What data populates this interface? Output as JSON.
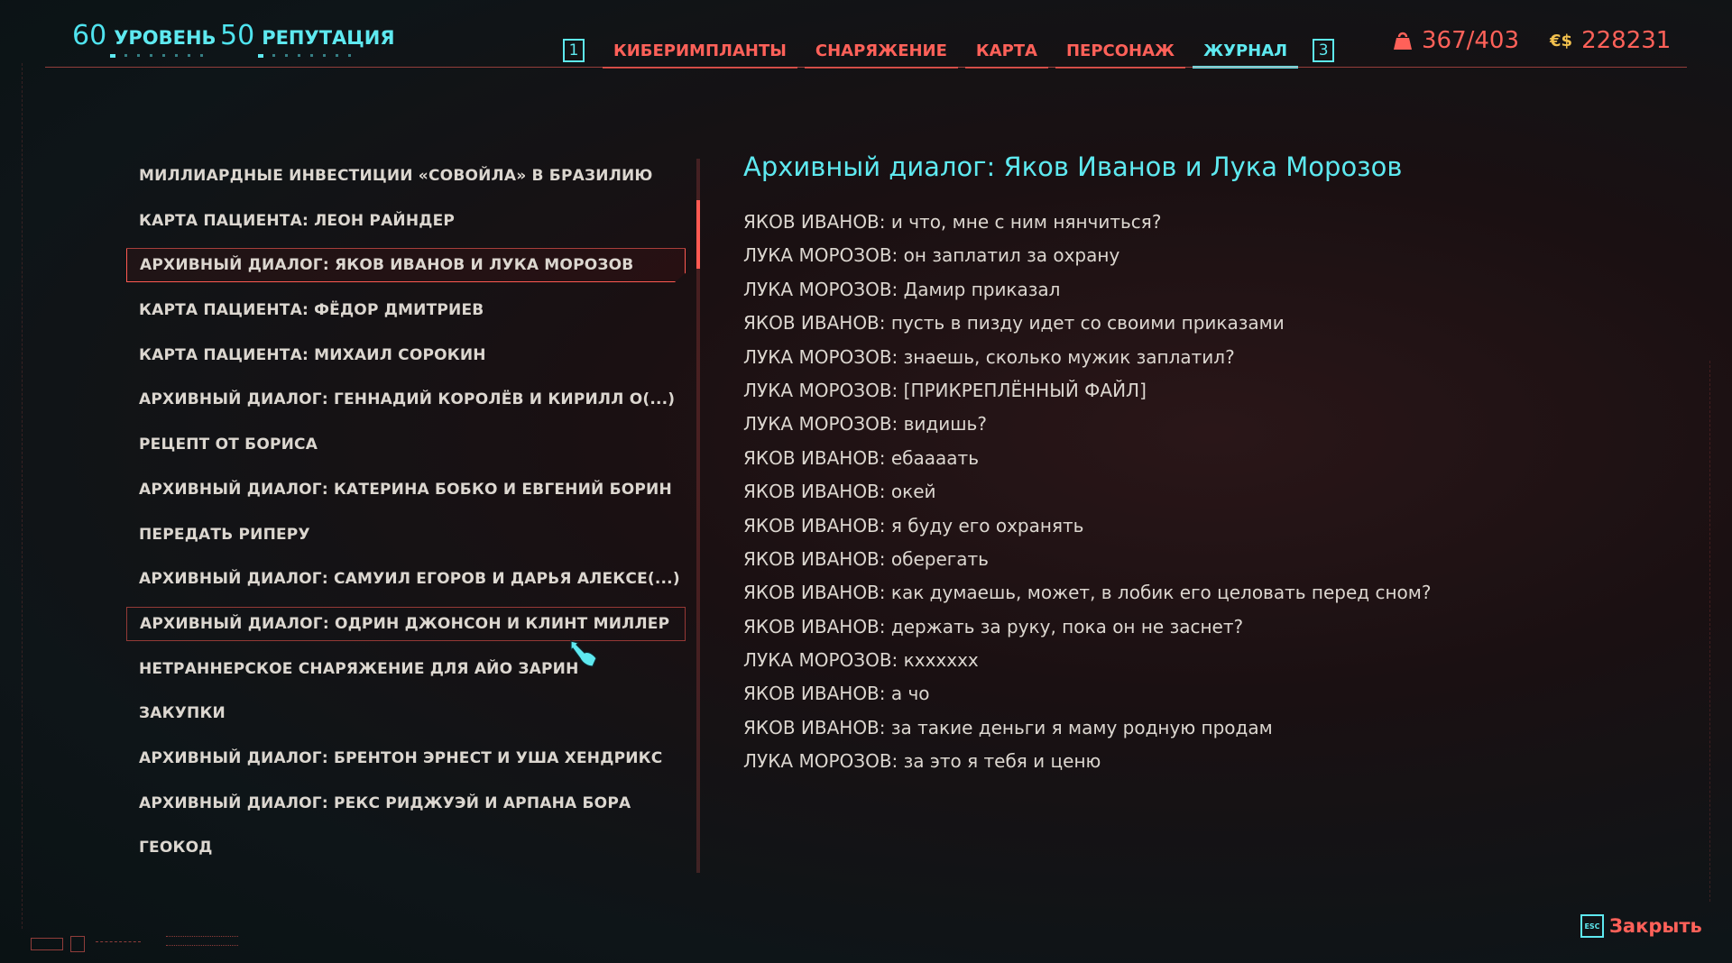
{
  "header": {
    "level": {
      "value": "60",
      "label": "УРОВЕНЬ"
    },
    "reputation": {
      "value": "50",
      "label": "РЕПУТАЦИЯ"
    },
    "nav": {
      "prev_key": "1",
      "next_key": "3",
      "tabs": [
        {
          "label": "КИБЕРИМПЛАНТЫ",
          "active": false
        },
        {
          "label": "СНАРЯЖЕНИЕ",
          "active": false
        },
        {
          "label": "КАРТА",
          "active": false
        },
        {
          "label": "ПЕРСОНАЖ",
          "active": false
        },
        {
          "label": "ЖУРНАЛ",
          "active": true
        }
      ]
    },
    "carry_weight": "367/403",
    "money": {
      "symbol": "€$",
      "value": "228231"
    }
  },
  "journal_list": {
    "items": [
      {
        "label": "МИЛЛИАРДНЫЕ ИНВЕСТИЦИИ «СОВОЙЛА» В БРАЗИЛИЮ"
      },
      {
        "label": "КАРТА ПАЦИЕНТА: ЛЕОН РАЙНДЕР"
      },
      {
        "label": "АРХИВНЫЙ ДИАЛОГ: ЯКОВ ИВАНОВ И ЛУКА МОРОЗОВ",
        "selected": true
      },
      {
        "label": "КАРТА ПАЦИЕНТА: ФЁДОР ДМИТРИЕВ"
      },
      {
        "label": "КАРТА ПАЦИЕНТА: МИХАИЛ СОРОКИН"
      },
      {
        "label": "АРХИВНЫЙ ДИАЛОГ: ГЕННАДИЙ КОРОЛЁВ И КИРИЛЛ О(...)"
      },
      {
        "label": "РЕЦЕПТ ОТ БОРИСА"
      },
      {
        "label": "АРХИВНЫЙ ДИАЛОГ: КАТЕРИНА БОБКО И ЕВГЕНИЙ БОРИН"
      },
      {
        "label": "ПЕРЕДАТЬ РИПЕРУ"
      },
      {
        "label": "АРХИВНЫЙ ДИАЛОГ: САМУИЛ ЕГОРОВ И ДАРЬЯ АЛЕКСЕ(...)"
      },
      {
        "label": "АРХИВНЫЙ ДИАЛОГ: ОДРИН ДЖОНСОН И КЛИНТ МИЛЛЕР",
        "hovered": true
      },
      {
        "label": "НЕТРАННЕРСКОЕ СНАРЯЖЕНИЕ ДЛЯ АЙО ЗАРИН"
      },
      {
        "label": "ЗАКУПКИ"
      },
      {
        "label": "АРХИВНЫЙ ДИАЛОГ: БРЕНТОН ЭРНЕСТ И УША ХЕНДРИКС"
      },
      {
        "label": "АРХИВНЫЙ ДИАЛОГ: РЕКС РИДЖУЭЙ И АРПАНА БОРА"
      },
      {
        "label": "ГЕОКОД"
      }
    ]
  },
  "detail": {
    "title": "Архивный диалог: Яков Иванов и Лука Морозов",
    "lines": [
      "ЯКОВ ИВАНОВ: и что, мне с ним нянчиться?",
      "ЛУКА МОРОЗОВ: он заплатил за охрану",
      "ЛУКА МОРОЗОВ: Дамир приказал",
      "ЯКОВ ИВАНОВ: пусть в пизду идет со своими приказами",
      "ЛУКА МОРОЗОВ: знаешь, сколько мужик заплатил?",
      "ЛУКА МОРОЗОВ: [ПРИКРЕПЛЁННЫЙ ФАЙЛ]",
      "ЛУКА МОРОЗОВ: видишь?",
      "ЯКОВ ИВАНОВ: ебаааать",
      "ЯКОВ ИВАНОВ: окей",
      "ЯКОВ ИВАНОВ: я буду его охранять",
      "ЯКОВ ИВАНОВ: оберегать",
      "ЯКОВ ИВАНОВ: как думаешь, может, в лобик его целовать перед сном?",
      "ЯКОВ ИВАНОВ: держать за руку, пока он не заснет?",
      "ЛУКА МОРОЗОВ: кхххххх",
      "ЯКОВ ИВАНОВ: а чо",
      "ЯКОВ ИВАНОВ: за такие деньги я маму родную продам",
      "ЛУКА МОРОЗОВ: за это я тебя и ценю"
    ]
  },
  "footer": {
    "esc_key": "ESC",
    "close_label": "Закрыть"
  },
  "colors": {
    "accent_red": "#ff6159",
    "accent_cyan": "#5ee9f0",
    "text": "#dcd7d0",
    "money_gold": "#f2c14e"
  }
}
